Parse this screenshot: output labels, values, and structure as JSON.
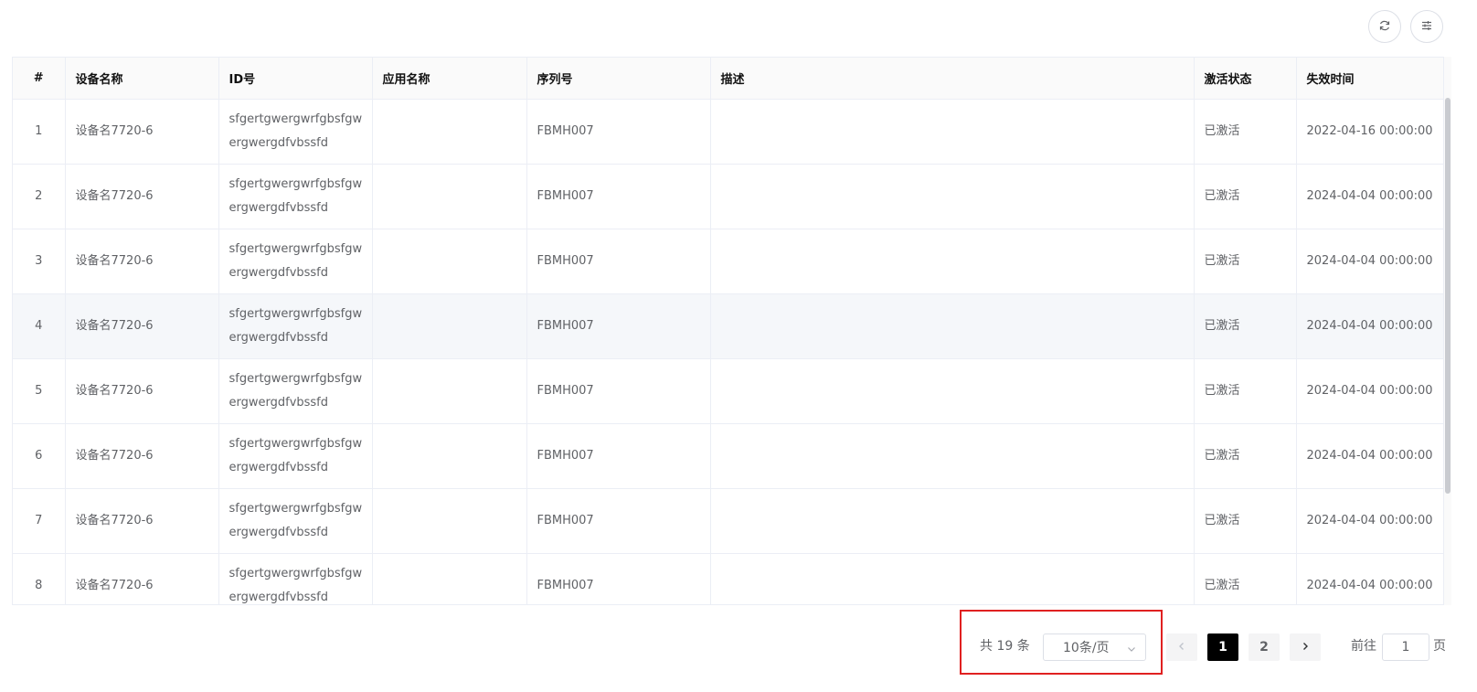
{
  "toolbar": {
    "refresh_icon": "refresh-icon",
    "columns_icon": "column-settings-icon"
  },
  "table": {
    "columns": [
      "#",
      "设备名称",
      "ID号",
      "应用名称",
      "序列号",
      "描述",
      "激活状态",
      "失效时间"
    ],
    "rows": [
      {
        "index": "1",
        "device_name": "设备名7720-6",
        "id": "sfgertgwergwrfgbsfgwergwergdfvbssfd",
        "app_name": "",
        "serial": "FBMH007",
        "description": "",
        "status": "已激活",
        "expire": "2022-04-16 00:00:00"
      },
      {
        "index": "2",
        "device_name": "设备名7720-6",
        "id": "sfgertgwergwrfgbsfgwergwergdfvbssfd",
        "app_name": "",
        "serial": "FBMH007",
        "description": "",
        "status": "已激活",
        "expire": "2024-04-04 00:00:00"
      },
      {
        "index": "3",
        "device_name": "设备名7720-6",
        "id": "sfgertgwergwrfgbsfgwergwergdfvbssfd",
        "app_name": "",
        "serial": "FBMH007",
        "description": "",
        "status": "已激活",
        "expire": "2024-04-04 00:00:00"
      },
      {
        "index": "4",
        "device_name": "设备名7720-6",
        "id": "sfgertgwergwrfgbsfgwergwergdfvbssfd",
        "app_name": "",
        "serial": "FBMH007",
        "description": "",
        "status": "已激活",
        "expire": "2024-04-04 00:00:00"
      },
      {
        "index": "5",
        "device_name": "设备名7720-6",
        "id": "sfgertgwergwrfgbsfgwergwergdfvbssfd",
        "app_name": "",
        "serial": "FBMH007",
        "description": "",
        "status": "已激活",
        "expire": "2024-04-04 00:00:00"
      },
      {
        "index": "6",
        "device_name": "设备名7720-6",
        "id": "sfgertgwergwrfgbsfgwergwergdfvbssfd",
        "app_name": "",
        "serial": "FBMH007",
        "description": "",
        "status": "已激活",
        "expire": "2024-04-04 00:00:00"
      },
      {
        "index": "7",
        "device_name": "设备名7720-6",
        "id": "sfgertgwergwrfgbsfgwergwergdfvbssfd",
        "app_name": "",
        "serial": "FBMH007",
        "description": "",
        "status": "已激活",
        "expire": "2024-04-04 00:00:00"
      },
      {
        "index": "8",
        "device_name": "设备名7720-6",
        "id": "sfgertgwergwrfgbsfgwergwergdfvbssfd",
        "app_name": "",
        "serial": "FBMH007",
        "description": "",
        "status": "已激活",
        "expire": "2024-04-04 00:00:00"
      }
    ]
  },
  "pagination": {
    "total_text": "共 19 条",
    "page_size": "10条/页",
    "pages": [
      "1",
      "2"
    ],
    "current_page": "1",
    "goto_prefix": "前往",
    "goto_value": "1",
    "goto_suffix": "页",
    "prev_icon": "chevron-left-icon",
    "next_icon": "chevron-right-icon"
  },
  "colors": {
    "active_page_bg": "#000000",
    "highlight_border": "#e02020",
    "header_bg": "#fafafa",
    "hover_row_bg": "#f5f7fa"
  }
}
